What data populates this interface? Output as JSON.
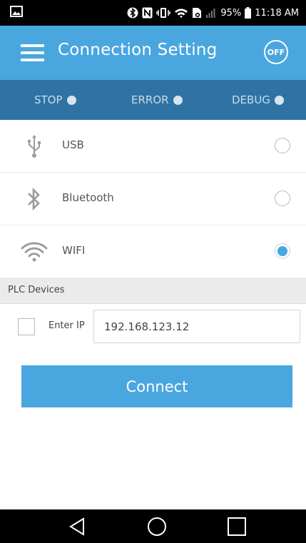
{
  "status_bar": {
    "battery_percent": "95%",
    "time": "11:18 AM"
  },
  "app_bar": {
    "title": "Connection Setting",
    "off_button_label": "OFF"
  },
  "indicators": [
    {
      "label": "STOP"
    },
    {
      "label": "ERROR"
    },
    {
      "label": "DEBUG"
    }
  ],
  "connection_options": [
    {
      "label": "USB",
      "icon": "usb-icon",
      "selected": false
    },
    {
      "label": "Bluetooth",
      "icon": "bluetooth-icon",
      "selected": false
    },
    {
      "label": "WIFI",
      "icon": "wifi-icon",
      "selected": true
    }
  ],
  "plc_devices": {
    "section_title": "PLC Devices",
    "enter_ip_label": "Enter IP",
    "enter_ip_checked": false,
    "ip_value": "192.168.123.12"
  },
  "connect_button": {
    "label": "Connect"
  },
  "colors": {
    "primary_blue": "#4aa6df",
    "status_strip_blue": "#2e73a4"
  }
}
